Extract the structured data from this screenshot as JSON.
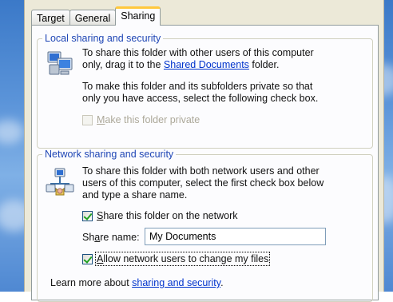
{
  "tabs": [
    {
      "label": "Target"
    },
    {
      "label": "General"
    },
    {
      "label": "Sharing"
    }
  ],
  "local": {
    "title": "Local sharing and security",
    "line1": "To share this folder with other users of this computer",
    "line2_before": "only, drag it to the ",
    "line2_link": "Shared Documents",
    "line2_after": " folder.",
    "private_line1": "To make this folder and its subfolders private so that",
    "private_line2": "only you have access, select the following check box.",
    "private_checkbox": {
      "label_first": "M",
      "label_rest": "ake this folder private",
      "checked": false,
      "enabled": false
    }
  },
  "network": {
    "title": "Network sharing and security",
    "line1": "To share this folder with both network users and other",
    "line2": "users of this computer, select the first check box below",
    "line3": "and type a share name.",
    "share_checkbox": {
      "label_first": "S",
      "label_rest": "hare this folder on the network",
      "checked": true
    },
    "share_name_label_before": "Sh",
    "share_name_label_u": "a",
    "share_name_label_after": "re name:",
    "share_name_value": "My Documents",
    "allow_checkbox": {
      "label_first": "A",
      "label_rest": "llow network users to change my files",
      "checked": true
    }
  },
  "learn_more": {
    "prefix": "Learn more about ",
    "link": "sharing and security",
    "suffix": "."
  },
  "icons": {
    "local": "shared-computers-icon",
    "network": "network-share-icon"
  }
}
